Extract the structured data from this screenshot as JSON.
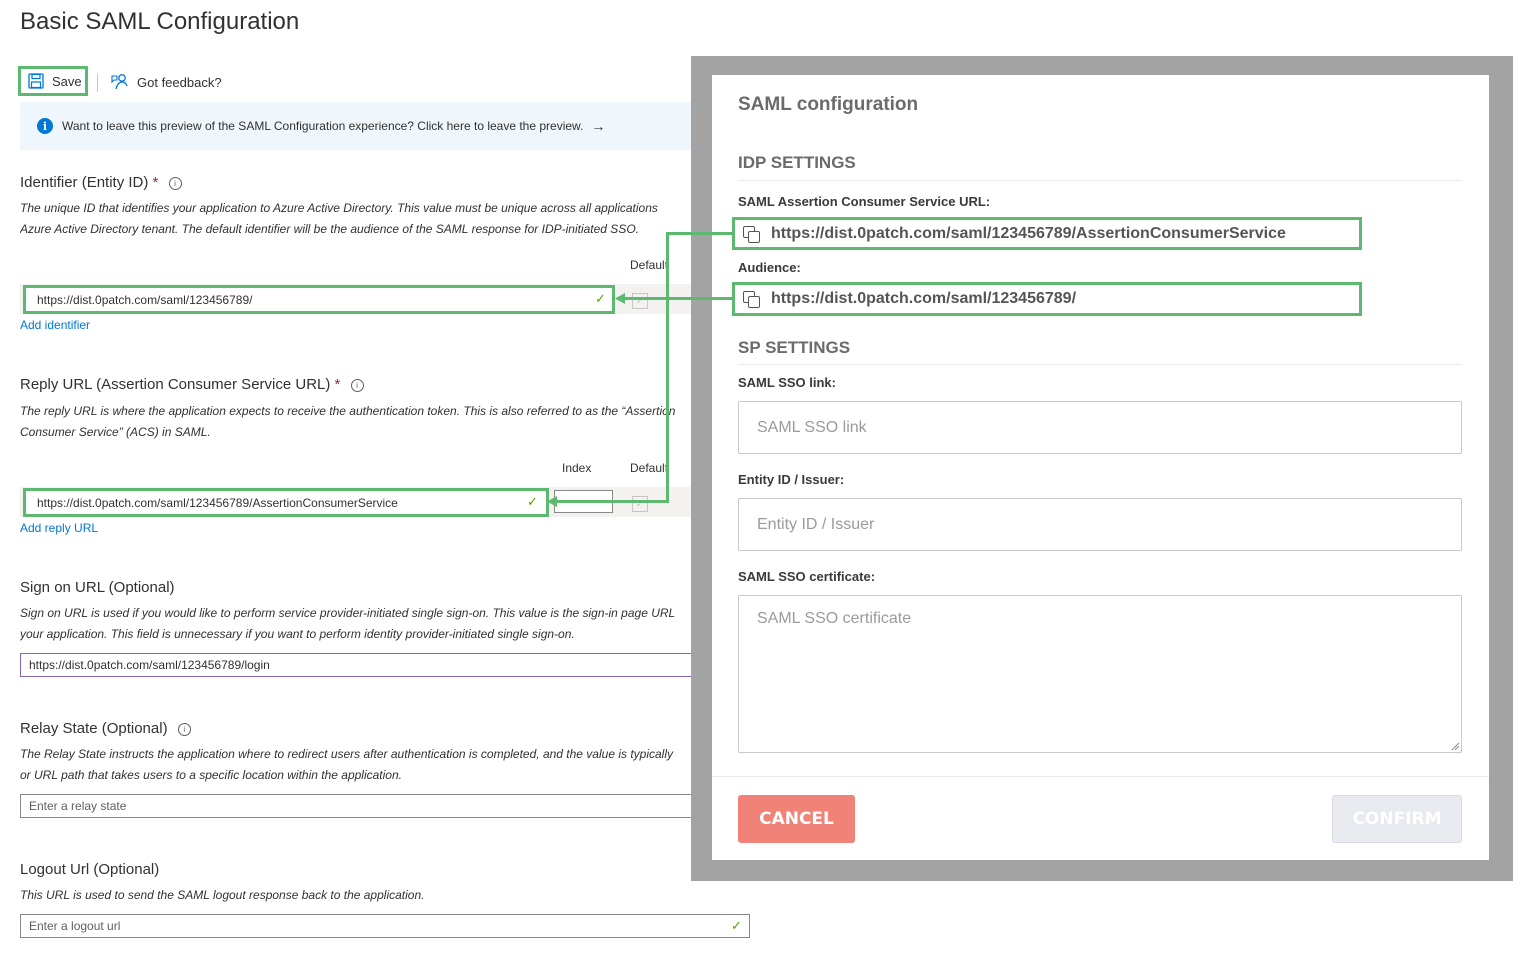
{
  "page": {
    "title": "Basic SAML Configuration"
  },
  "toolbar": {
    "save_label": "Save",
    "feedback_label": "Got feedback?"
  },
  "infobar": {
    "text": "Want to leave this preview of the SAML Configuration experience? Click here to leave the preview.",
    "arrow": "→"
  },
  "identifier": {
    "label": "Identifier (Entity ID)",
    "required_mark": "*",
    "desc_line1": "The unique ID that identifies your application to Azure Active Directory. This value must be unique across all applications",
    "desc_line2": "Azure Active Directory tenant. The default identifier will be the audience of the SAML response for IDP-initiated SSO.",
    "default_col": "Default",
    "value": "https://dist.0patch.com/saml/123456789/",
    "add_link": "Add identifier"
  },
  "reply_url": {
    "label": "Reply URL (Assertion Consumer Service URL)",
    "required_mark": "*",
    "desc_line1": "The reply URL is where the application expects to receive the authentication token. This is also referred to as the “Assertion",
    "desc_line2": "Consumer Service” (ACS) in SAML.",
    "index_col": "Index",
    "default_col": "Default",
    "value": "https://dist.0patch.com/saml/123456789/AssertionConsumerService",
    "add_link": "Add reply URL"
  },
  "sign_on": {
    "label": "Sign on URL (Optional)",
    "desc_line1": "Sign on URL is used if you would like to perform service provider-initiated single sign-on. This value is the sign-in page URL",
    "desc_line2": "your application. This field is unnecessary if you want to perform identity provider-initiated single sign-on.",
    "value": "https://dist.0patch.com/saml/123456789/login"
  },
  "relay_state": {
    "label": "Relay State (Optional)",
    "desc_line1": "The Relay State instructs the application where to redirect users after authentication is completed, and the value is typically",
    "desc_line2": "or URL path that takes users to a specific location within the application.",
    "placeholder": "Enter a relay state"
  },
  "logout": {
    "label": "Logout Url (Optional)",
    "desc_line1": "This URL is used to send the SAML logout response back to the application.",
    "placeholder": "Enter a logout url"
  },
  "modal": {
    "title": "SAML configuration",
    "idp_section": "IDP SETTINGS",
    "acs_label": "SAML Assertion Consumer Service URL:",
    "acs_value": "https://dist.0patch.com/saml/123456789/AssertionConsumerService",
    "audience_label": "Audience:",
    "audience_value": "https://dist.0patch.com/saml/123456789/",
    "sp_section": "SP SETTINGS",
    "sso_link_label": "SAML SSO link:",
    "sso_link_placeholder": "SAML SSO link",
    "entity_label": "Entity ID / Issuer:",
    "entity_placeholder": "Entity ID / Issuer",
    "cert_label": "SAML SSO certificate:",
    "cert_placeholder": "SAML SSO certificate",
    "cancel_label": "CANCEL",
    "confirm_label": "CONFIRM"
  },
  "colors": {
    "highlight": "#5cb96f",
    "link": "#0078d4",
    "cancel": "#f08277",
    "overlay": "#a3a3a3"
  }
}
